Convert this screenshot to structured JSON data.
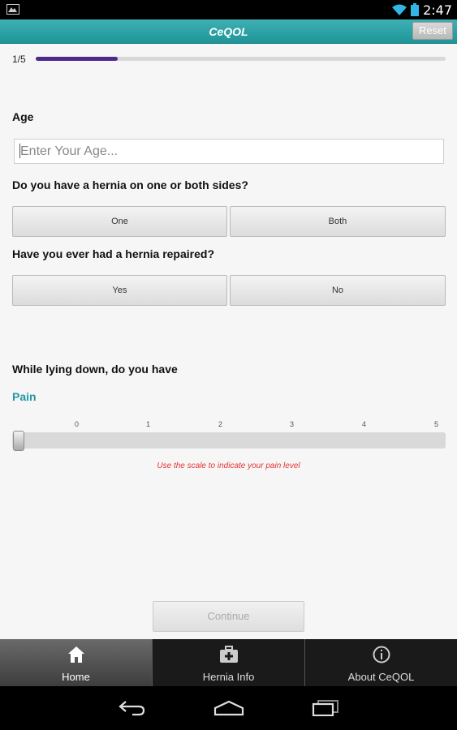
{
  "status": {
    "time": "2:47"
  },
  "app": {
    "title": "CeQOL",
    "reset_label": "Reset"
  },
  "progress": {
    "label": "1/5",
    "step": 1,
    "total": 5,
    "fraction": 0.2
  },
  "form": {
    "age": {
      "label": "Age",
      "placeholder": "Enter Your Age...",
      "value": ""
    },
    "hernia_sides": {
      "question": "Do you have a hernia on one or both sides?",
      "options": [
        "One",
        "Both"
      ]
    },
    "hernia_repaired": {
      "question": "Have you ever had a hernia repaired?",
      "options": [
        "Yes",
        "No"
      ]
    },
    "lying_down": {
      "question": "While lying down, do you have",
      "symptom": "Pain",
      "scale": [
        "0",
        "1",
        "2",
        "3",
        "4",
        "5"
      ],
      "value": 0,
      "hint": "Use the scale to indicate your pain level"
    },
    "continue_label": "Continue"
  },
  "tabs": [
    {
      "label": "Home",
      "icon": "home-icon",
      "active": true
    },
    {
      "label": "Hernia Info",
      "icon": "medical-kit-icon",
      "active": false
    },
    {
      "label": "About CeQOL",
      "icon": "info-icon",
      "active": false
    }
  ],
  "colors": {
    "action_bar": "#2aa3a6",
    "progress": "#4b2a8c",
    "pain_label": "#2497a6",
    "hint": "#e53333"
  }
}
